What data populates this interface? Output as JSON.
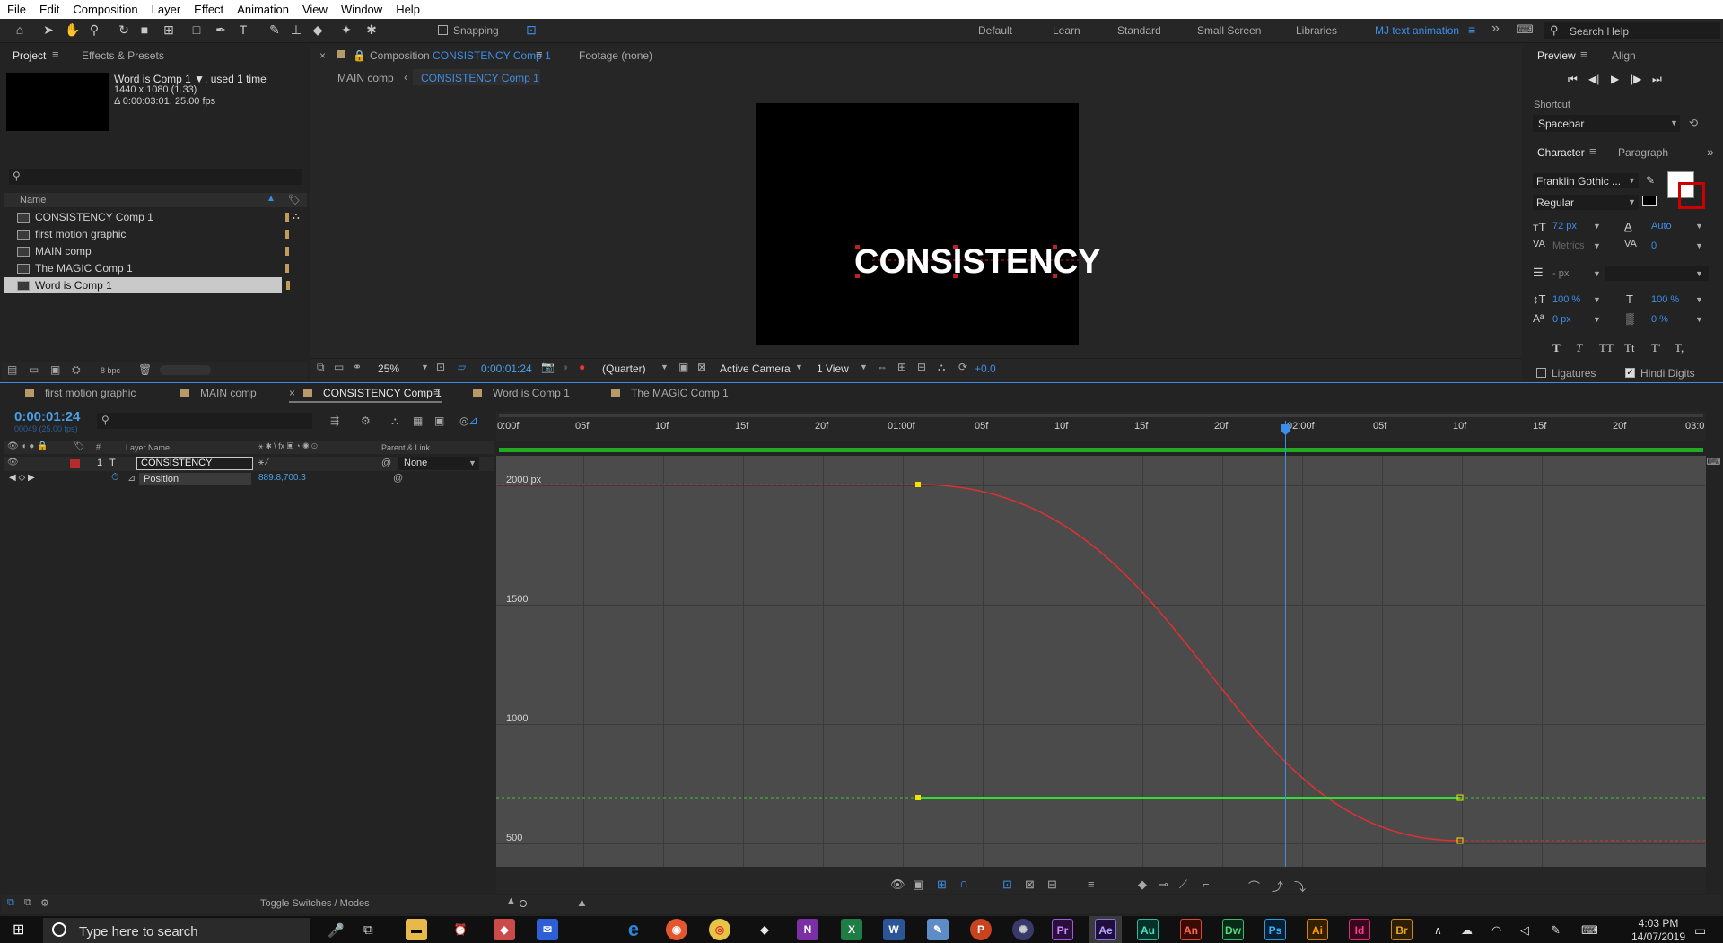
{
  "menu": [
    "File",
    "Edit",
    "Composition",
    "Layer",
    "Effect",
    "Animation",
    "View",
    "Window",
    "Help"
  ],
  "toolbar": {
    "snapping": "Snapping",
    "workspaces": [
      "Default",
      "Learn",
      "Standard",
      "Small Screen",
      "Libraries",
      "MJ text animation"
    ],
    "search": "Search Help"
  },
  "project": {
    "tab": "Project",
    "tab2": "Effects & Presets",
    "comp_name": "Word is Comp 1",
    "used": ", used 1 time",
    "dims": "1440 x 1080 (1.33)",
    "duration": "Δ 0:00:03:01, 25.00 fps",
    "search_icon": "⚲",
    "col_name": "Name",
    "items": [
      "CONSISTENCY Comp 1",
      "first motion graphic",
      "MAIN comp",
      "The MAGIC  Comp 1",
      "Word is Comp 1"
    ],
    "bpc": "8 bpc"
  },
  "viewer": {
    "tab_prefix": "Composition",
    "tab_comp": "CONSISTENCY Comp 1",
    "footage": "Footage  (none)",
    "crumb1": "MAIN comp",
    "crumb2": "CONSISTENCY Comp 1",
    "overlay_text": "CONSISTENCY",
    "zoom": "25%",
    "timecode": "0:00:01:24",
    "resolution": "(Quarter)",
    "camera": "Active Camera",
    "views": "1 View",
    "exposure": "+0.0"
  },
  "preview": {
    "tab": "Preview",
    "tab2": "Align",
    "shortcut_label": "Shortcut",
    "shortcut": "Spacebar"
  },
  "character": {
    "tab": "Character",
    "tab2": "Paragraph",
    "font": "Franklin Gothic ...",
    "style": "Regular",
    "size": "72 px",
    "leading": "Auto",
    "kerning": "Metrics",
    "tracking": "0",
    "stroke": "- px",
    "vscale": "100 %",
    "hscale": "100 %",
    "baseline": "0 px",
    "tsume": "0 %",
    "ligatures": "Ligatures",
    "hindi": "Hindi Digits",
    "typo": [
      "T",
      "T",
      "TT",
      "Tt",
      "T'",
      "T,"
    ]
  },
  "timeline": {
    "tabs": [
      "first motion graphic",
      "MAIN comp",
      "CONSISTENCY Comp 1",
      "Word is Comp 1",
      "The MAGIC  Comp 1"
    ],
    "active_tab": 2,
    "timecode": "0:00:01:24",
    "frames": "00049 (25.00 fps)",
    "layer_num": "1",
    "layer_name": "CONSISTENCY",
    "parent": "None",
    "prop": "Position",
    "prop_value": "889.8,700.3",
    "col_source": "Layer Name",
    "col_parent": "Parent & Link",
    "toggle": "Toggle Switches / Modes",
    "ticks": [
      "0:00f",
      "05f",
      "10f",
      "15f",
      "20f",
      "01:00f",
      "05f",
      "10f",
      "15f",
      "20f",
      "02:00f",
      "05f",
      "10f",
      "15f",
      "20f",
      "03:0"
    ],
    "ylabels": [
      "2000 px",
      "1500",
      "1000",
      "500"
    ]
  },
  "graph": {
    "red_curve": "#e03030",
    "green_line": "#33dd33",
    "keyframe": "#f5e400"
  },
  "taskbar": {
    "search": "Type here to search",
    "time": "4:03 PM",
    "date": "14/07/2019",
    "apps": [
      "Pr",
      "Ae",
      "Au",
      "An",
      "Dw",
      "Ps",
      "Ai",
      "Id",
      "Br"
    ]
  }
}
